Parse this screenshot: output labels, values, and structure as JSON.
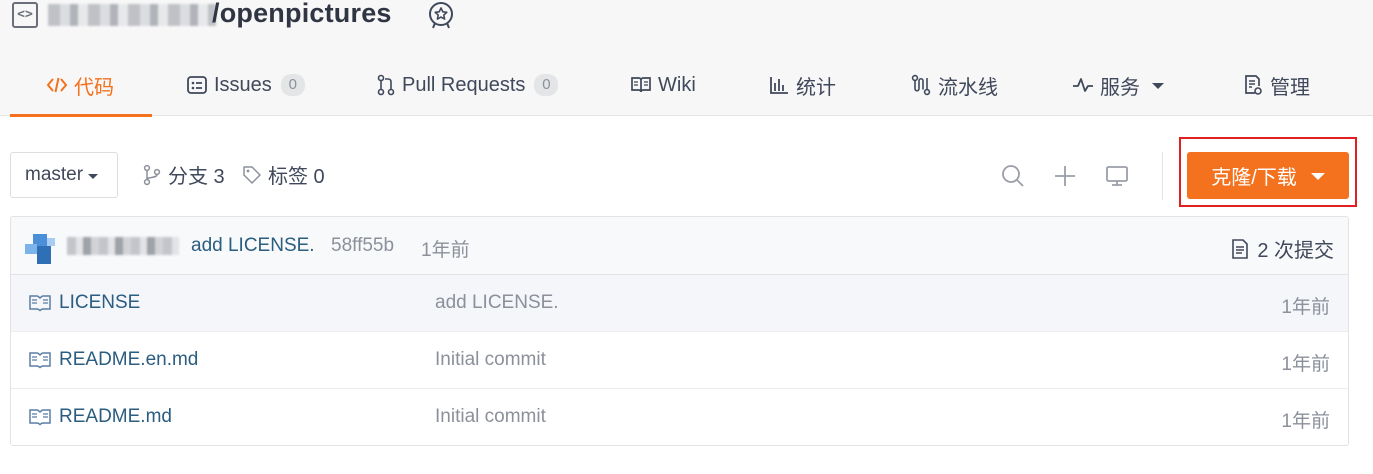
{
  "repo": {
    "name": "/openpictures"
  },
  "tabs": [
    {
      "label": "代码",
      "icon": "code-icon",
      "count": null,
      "active": true
    },
    {
      "label": "Issues",
      "icon": "issues-icon",
      "count": "0",
      "active": false
    },
    {
      "label": "Pull Requests",
      "icon": "pull-request-icon",
      "count": "0",
      "active": false
    },
    {
      "label": "Wiki",
      "icon": "book-icon",
      "count": null,
      "active": false
    },
    {
      "label": "统计",
      "icon": "bar-chart-icon",
      "count": null,
      "active": false
    },
    {
      "label": "流水线",
      "icon": "pipeline-icon",
      "count": null,
      "active": false
    },
    {
      "label": "服务",
      "icon": "pulse-icon",
      "count": null,
      "active": false
    },
    {
      "label": "管理",
      "icon": "settings-doc-icon",
      "count": null,
      "active": false
    }
  ],
  "toolbar": {
    "branch": "master",
    "branches_label": "分支 3",
    "tags_label": "标签 0",
    "clone_label": "克隆/下载"
  },
  "commit": {
    "message": "add LICENSE.",
    "hash": "58ff55b",
    "time": "1年前",
    "count_label": "2 次提交"
  },
  "files": [
    {
      "name": "LICENSE",
      "message": "add LICENSE.",
      "time": "1年前"
    },
    {
      "name": "README.en.md",
      "message": "Initial commit",
      "time": "1年前"
    },
    {
      "name": "README.md",
      "message": "Initial commit",
      "time": "1年前"
    }
  ],
  "colors": {
    "accent": "#f4711d",
    "link": "#2a5d80",
    "muted": "#8b909b",
    "highlight_border": "#e02020"
  }
}
